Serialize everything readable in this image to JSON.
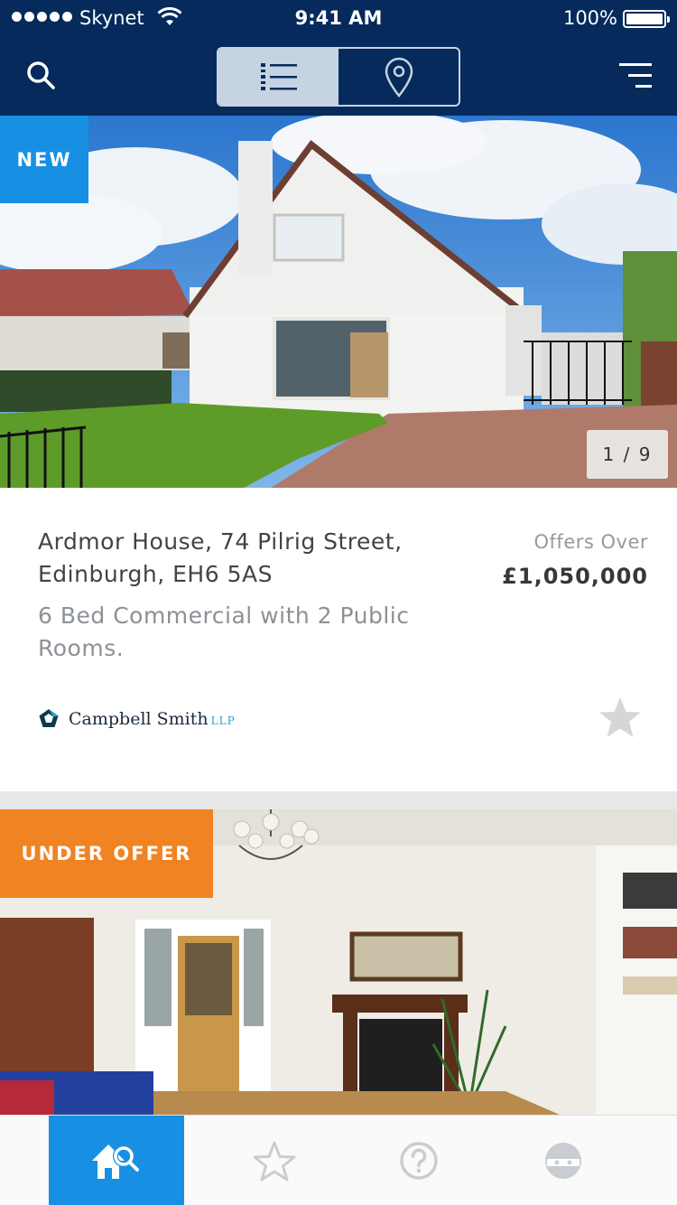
{
  "status_bar": {
    "carrier": "Skynet",
    "time": "9:41 AM",
    "battery": "100%"
  },
  "nav": {
    "search_icon": "search-icon",
    "list_view_icon": "list-icon",
    "map_view_icon": "map-pin-icon",
    "active_view": "list",
    "menu_icon": "menu-icon"
  },
  "listings": [
    {
      "badge": "NEW",
      "photo_counter": "1 / 9",
      "address": "Ardmor House, 74 Pilrig Street, Edinburgh, EH6 5AS",
      "description": "6 Bed Commercial with 2 Public Rooms.",
      "price_label": "Offers Over",
      "price": "£1,050,000",
      "agent_name": "Campbell Smith",
      "agent_suffix": "LLP"
    },
    {
      "badge": "UNDER OFFER"
    }
  ],
  "tabs": [
    {
      "icon": "home-search-icon",
      "active": true
    },
    {
      "icon": "star-icon",
      "active": false
    },
    {
      "icon": "help-icon",
      "active": false
    },
    {
      "icon": "profile-icon",
      "active": false
    }
  ],
  "colors": {
    "nav_bg": "#062a5c",
    "accent_blue": "#1790e3",
    "offer_orange": "#f08322"
  }
}
